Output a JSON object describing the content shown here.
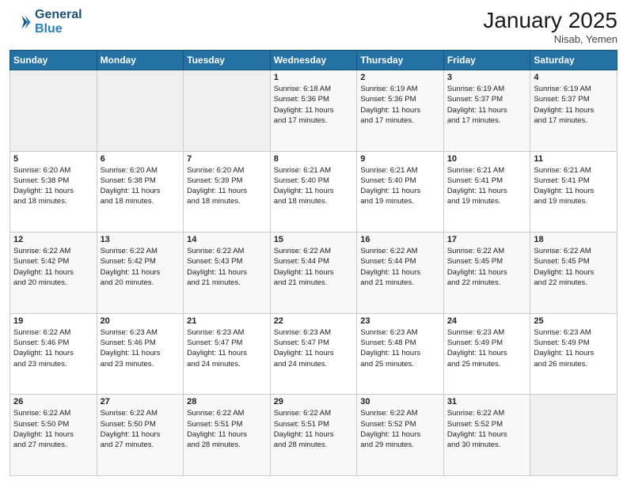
{
  "header": {
    "logo_line1": "General",
    "logo_line2": "Blue",
    "month_year": "January 2025",
    "location": "Nisab, Yemen"
  },
  "weekdays": [
    "Sunday",
    "Monday",
    "Tuesday",
    "Wednesday",
    "Thursday",
    "Friday",
    "Saturday"
  ],
  "weeks": [
    [
      {
        "day": "",
        "text": ""
      },
      {
        "day": "",
        "text": ""
      },
      {
        "day": "",
        "text": ""
      },
      {
        "day": "1",
        "text": "Sunrise: 6:18 AM\nSunset: 5:36 PM\nDaylight: 11 hours\nand 17 minutes."
      },
      {
        "day": "2",
        "text": "Sunrise: 6:19 AM\nSunset: 5:36 PM\nDaylight: 11 hours\nand 17 minutes."
      },
      {
        "day": "3",
        "text": "Sunrise: 6:19 AM\nSunset: 5:37 PM\nDaylight: 11 hours\nand 17 minutes."
      },
      {
        "day": "4",
        "text": "Sunrise: 6:19 AM\nSunset: 5:37 PM\nDaylight: 11 hours\nand 17 minutes."
      }
    ],
    [
      {
        "day": "5",
        "text": "Sunrise: 6:20 AM\nSunset: 5:38 PM\nDaylight: 11 hours\nand 18 minutes."
      },
      {
        "day": "6",
        "text": "Sunrise: 6:20 AM\nSunset: 5:38 PM\nDaylight: 11 hours\nand 18 minutes."
      },
      {
        "day": "7",
        "text": "Sunrise: 6:20 AM\nSunset: 5:39 PM\nDaylight: 11 hours\nand 18 minutes."
      },
      {
        "day": "8",
        "text": "Sunrise: 6:21 AM\nSunset: 5:40 PM\nDaylight: 11 hours\nand 18 minutes."
      },
      {
        "day": "9",
        "text": "Sunrise: 6:21 AM\nSunset: 5:40 PM\nDaylight: 11 hours\nand 19 minutes."
      },
      {
        "day": "10",
        "text": "Sunrise: 6:21 AM\nSunset: 5:41 PM\nDaylight: 11 hours\nand 19 minutes."
      },
      {
        "day": "11",
        "text": "Sunrise: 6:21 AM\nSunset: 5:41 PM\nDaylight: 11 hours\nand 19 minutes."
      }
    ],
    [
      {
        "day": "12",
        "text": "Sunrise: 6:22 AM\nSunset: 5:42 PM\nDaylight: 11 hours\nand 20 minutes."
      },
      {
        "day": "13",
        "text": "Sunrise: 6:22 AM\nSunset: 5:42 PM\nDaylight: 11 hours\nand 20 minutes."
      },
      {
        "day": "14",
        "text": "Sunrise: 6:22 AM\nSunset: 5:43 PM\nDaylight: 11 hours\nand 21 minutes."
      },
      {
        "day": "15",
        "text": "Sunrise: 6:22 AM\nSunset: 5:44 PM\nDaylight: 11 hours\nand 21 minutes."
      },
      {
        "day": "16",
        "text": "Sunrise: 6:22 AM\nSunset: 5:44 PM\nDaylight: 11 hours\nand 21 minutes."
      },
      {
        "day": "17",
        "text": "Sunrise: 6:22 AM\nSunset: 5:45 PM\nDaylight: 11 hours\nand 22 minutes."
      },
      {
        "day": "18",
        "text": "Sunrise: 6:22 AM\nSunset: 5:45 PM\nDaylight: 11 hours\nand 22 minutes."
      }
    ],
    [
      {
        "day": "19",
        "text": "Sunrise: 6:22 AM\nSunset: 5:46 PM\nDaylight: 11 hours\nand 23 minutes."
      },
      {
        "day": "20",
        "text": "Sunrise: 6:23 AM\nSunset: 5:46 PM\nDaylight: 11 hours\nand 23 minutes."
      },
      {
        "day": "21",
        "text": "Sunrise: 6:23 AM\nSunset: 5:47 PM\nDaylight: 11 hours\nand 24 minutes."
      },
      {
        "day": "22",
        "text": "Sunrise: 6:23 AM\nSunset: 5:47 PM\nDaylight: 11 hours\nand 24 minutes."
      },
      {
        "day": "23",
        "text": "Sunrise: 6:23 AM\nSunset: 5:48 PM\nDaylight: 11 hours\nand 25 minutes."
      },
      {
        "day": "24",
        "text": "Sunrise: 6:23 AM\nSunset: 5:49 PM\nDaylight: 11 hours\nand 25 minutes."
      },
      {
        "day": "25",
        "text": "Sunrise: 6:23 AM\nSunset: 5:49 PM\nDaylight: 11 hours\nand 26 minutes."
      }
    ],
    [
      {
        "day": "26",
        "text": "Sunrise: 6:22 AM\nSunset: 5:50 PM\nDaylight: 11 hours\nand 27 minutes."
      },
      {
        "day": "27",
        "text": "Sunrise: 6:22 AM\nSunset: 5:50 PM\nDaylight: 11 hours\nand 27 minutes."
      },
      {
        "day": "28",
        "text": "Sunrise: 6:22 AM\nSunset: 5:51 PM\nDaylight: 11 hours\nand 28 minutes."
      },
      {
        "day": "29",
        "text": "Sunrise: 6:22 AM\nSunset: 5:51 PM\nDaylight: 11 hours\nand 28 minutes."
      },
      {
        "day": "30",
        "text": "Sunrise: 6:22 AM\nSunset: 5:52 PM\nDaylight: 11 hours\nand 29 minutes."
      },
      {
        "day": "31",
        "text": "Sunrise: 6:22 AM\nSunset: 5:52 PM\nDaylight: 11 hours\nand 30 minutes."
      },
      {
        "day": "",
        "text": ""
      }
    ]
  ]
}
